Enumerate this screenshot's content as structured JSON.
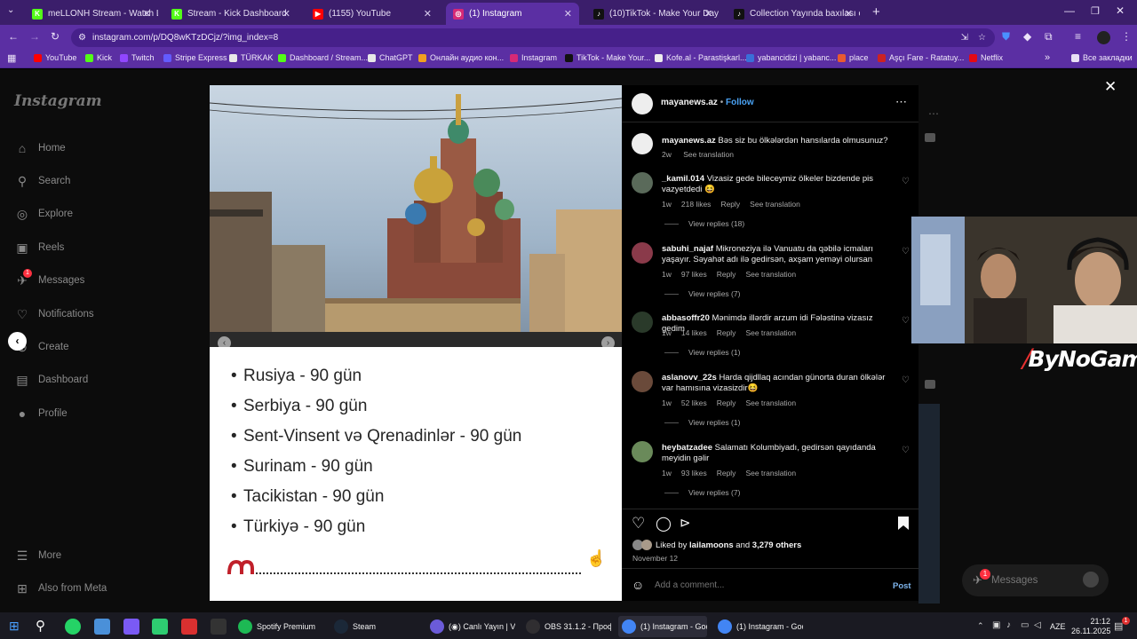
{
  "browser": {
    "tabs": [
      {
        "title": "meLLONH Stream - Watch Live",
        "fav_color": "#53fc18",
        "fav_glyph": "K"
      },
      {
        "title": "Stream - Kick Dashboard",
        "fav_color": "#53fc18",
        "fav_glyph": "K"
      },
      {
        "title": "(1155) YouTube",
        "fav_color": "#ff0000",
        "fav_glyph": "▶"
      },
      {
        "title": "(1) Instagram",
        "fav_color": "#d62976",
        "fav_glyph": "◎"
      },
      {
        "title": "(10)TikTok - Make Your Day",
        "fav_color": "#111111",
        "fav_glyph": "♪"
      },
      {
        "title": "Collection Yayında baxılası cr",
        "fav_color": "#111111",
        "fav_glyph": "♪"
      }
    ],
    "url": "instagram.com/p/DQ8wKTzDCjz/?img_index=8",
    "bookmarks": [
      {
        "label": "YouTube",
        "color": "#ff0000"
      },
      {
        "label": "Kick",
        "color": "#53fc18"
      },
      {
        "label": "Twitch",
        "color": "#9146ff"
      },
      {
        "label": "Stripe Express",
        "color": "#635bff"
      },
      {
        "label": "TÜRKAK",
        "color": "#e8e8e8"
      },
      {
        "label": "Dashboard / Stream...",
        "color": "#53fc18"
      },
      {
        "label": "ChatGPT",
        "color": "#e8e8e8"
      },
      {
        "label": "Онлайн аудио кон...",
        "color": "#f0a020"
      },
      {
        "label": "Instagram",
        "color": "#d62976"
      },
      {
        "label": "TikTok - Make Your...",
        "color": "#111111"
      },
      {
        "label": "Kofe.al - Parastişkarl...",
        "color": "#eeeeee"
      },
      {
        "label": "yabancidizi | yabanc...",
        "color": "#3a6fd8"
      },
      {
        "label": "place",
        "color": "#e85a30"
      },
      {
        "label": "Aşçı Fare - Ratatuy...",
        "color": "#cc2222"
      },
      {
        "label": "Netflix",
        "color": "#e50914"
      }
    ],
    "all_bookmarks": "Все закладки"
  },
  "instagram": {
    "logo": "Instagram",
    "nav": [
      {
        "label": "Home",
        "icon": "home-icon",
        "glyph": "⌂"
      },
      {
        "label": "Search",
        "icon": "search-icon",
        "glyph": "⚲"
      },
      {
        "label": "Explore",
        "icon": "explore-icon",
        "glyph": "◎"
      },
      {
        "label": "Reels",
        "icon": "reels-icon",
        "glyph": "▣"
      },
      {
        "label": "Messages",
        "icon": "messages-icon",
        "glyph": "✈",
        "badge": "1"
      },
      {
        "label": "Notifications",
        "icon": "heart-icon",
        "glyph": "♡"
      },
      {
        "label": "Create",
        "icon": "create-icon",
        "glyph": "⊕"
      },
      {
        "label": "Dashboard",
        "icon": "dashboard-icon",
        "glyph": "▤"
      },
      {
        "label": "Profile",
        "icon": "avatar-icon",
        "glyph": "●"
      }
    ],
    "more": "More",
    "also_from_meta": "Also from Meta",
    "floating_messages": "Messages",
    "floating_badge": "1"
  },
  "post": {
    "country_list": [
      "Rusiya - 90 gün",
      "Serbiya - 90 gün",
      "Sent-Vinsent və Qrenadinlər - 90 gün",
      "Surinam - 90 gün",
      "Tacikistan - 90 gün",
      "Türkiyə - 90 gün"
    ],
    "author": "mayanews.az",
    "follow": "Follow",
    "caption": "Bəs siz bu ölkələrdən hansılarda olmusunuz?",
    "caption_time": "2w",
    "see_translation": "See translation",
    "reply": "Reply",
    "comments": [
      {
        "user": "_kamil.014",
        "text": "Vizasiz gede bileceymiz ölkeler bizdende pis vazyetdedi 😆",
        "time": "1w",
        "likes": "218 likes",
        "view_replies": "View replies (18)"
      },
      {
        "user": "sabuhi_najaf",
        "text": "Mikroneziya ilə Vanuatu da qəbilə icmaları yaşayır. Səyahət adı ilə gedirsən, axşam yeməyi olursan",
        "time": "1w",
        "likes": "97 likes",
        "view_replies": "View replies (7)"
      },
      {
        "user": "abbasoffr20",
        "text": "Mənimdə illərdir arzum idi Fələstinə vizasız gedim",
        "time": "1w",
        "likes": "14 likes",
        "view_replies": "View replies (1)"
      },
      {
        "user": "aslanovv_22s",
        "text": "Harda qijdllaq acından günorta duran ölkələr var hamısına vizasizdir😆",
        "time": "1w",
        "likes": "52 likes",
        "view_replies": "View replies (1)"
      },
      {
        "user": "heybatzadee",
        "text": "Salamatı Kolumbiyadı, gedirsən qayıdanda meyidin gəlir",
        "time": "1w",
        "likes": "93 likes",
        "view_replies": "View replies (7)"
      }
    ],
    "liked_by_prefix": "Liked by",
    "liked_by_user": "lailamoons",
    "liked_by_and": "and",
    "liked_by_others": "3,279 others",
    "date": "November 12",
    "add_comment_placeholder": "Add a comment...",
    "post_button": "Post"
  },
  "webcam": {
    "brand": "ByNoGame"
  },
  "taskbar": {
    "apps": [
      {
        "label": "Spotify Premium",
        "color": "#1db954"
      },
      {
        "label": "Steam",
        "color": "#1b2838"
      },
      {
        "label": "(◉) Canlı Yayın | V...",
        "color": "#6b5bd8"
      },
      {
        "label": "OBS 31.1.2 - Проф...",
        "color": "#302e31"
      },
      {
        "label": "(1) Instagram - Goo...",
        "color": "#4285f4"
      },
      {
        "label": "(1) Instagram - Goo...",
        "color": "#4285f4"
      }
    ],
    "lang": "AZE",
    "time": "21:12",
    "date": "26.11.2025",
    "notification_badge": "1"
  }
}
